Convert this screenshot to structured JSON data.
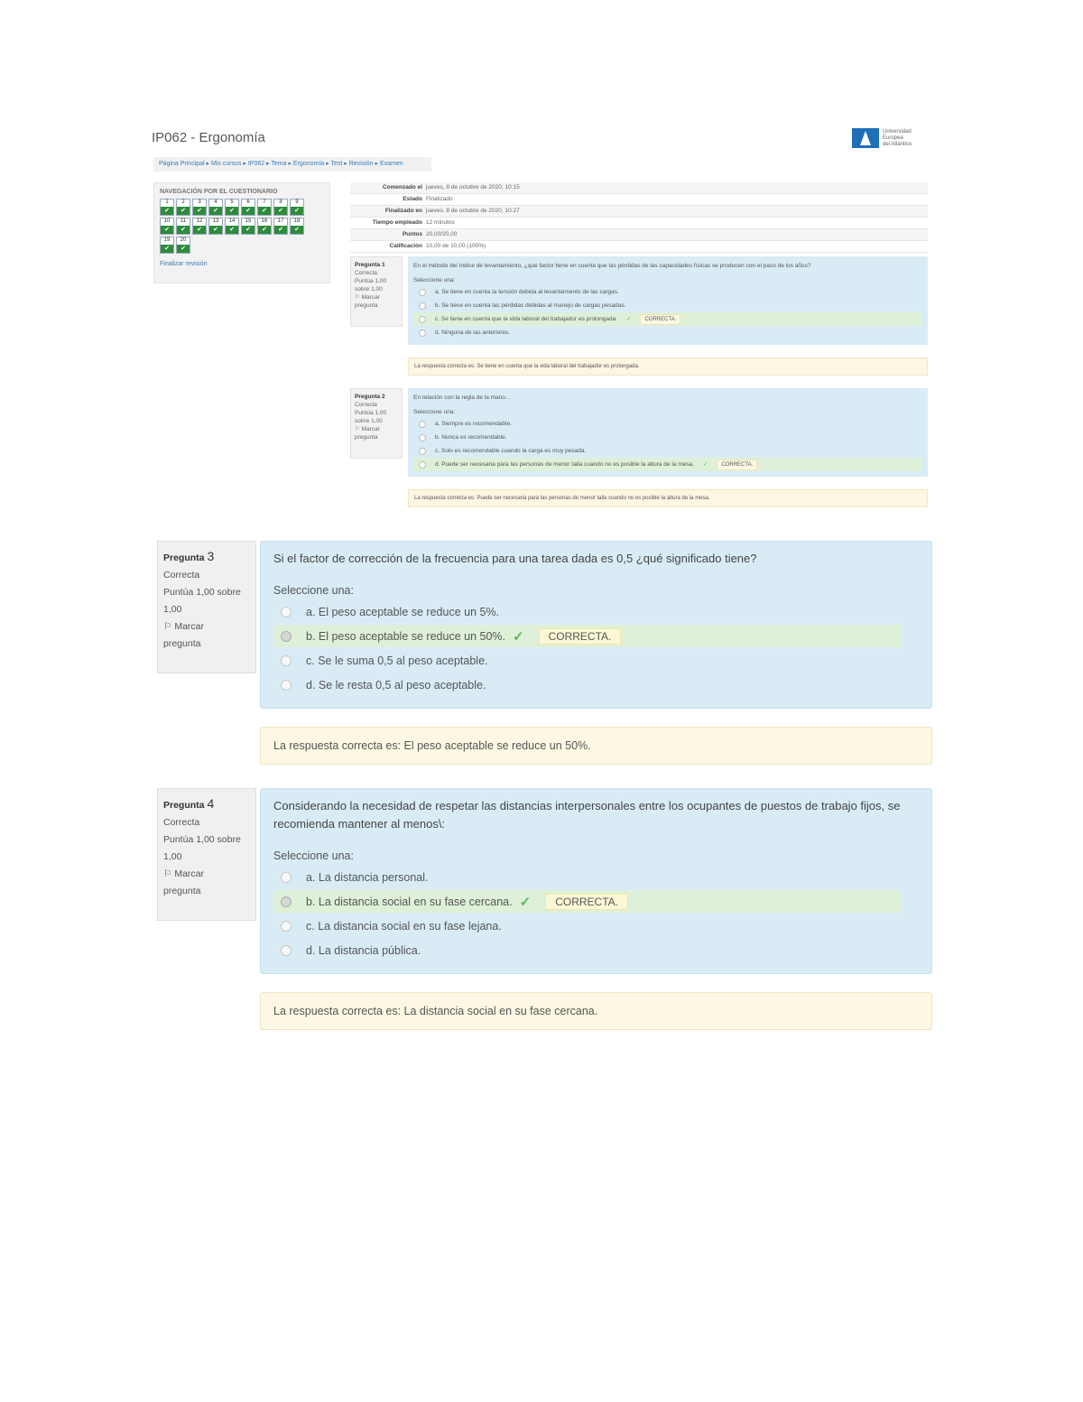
{
  "header": {
    "course_title": "IP062 - Ergonomía",
    "logo_line1": "Universidad",
    "logo_line2": "Europea",
    "logo_line3": "del Atlántico",
    "breadcrumb": "Página Principal ▸ Mis cursos ▸ IP062 ▸ Tema ▸ Ergonomía ▸ Test ▸ Revisión ▸ Examen"
  },
  "nav": {
    "title": "NAVEGACIÓN POR EL CUESTIONARIO",
    "questions": [
      "1",
      "2",
      "3",
      "4",
      "5",
      "6",
      "7",
      "8",
      "9",
      "10",
      "11",
      "12",
      "13",
      "14",
      "15",
      "16",
      "17",
      "18",
      "19",
      "20"
    ],
    "check_glyph": "✔",
    "finish_link": "Finalizar revisión"
  },
  "summary": [
    {
      "k": "Comenzado el",
      "v": "jueves, 8 de octubre de 2020, 10:15"
    },
    {
      "k": "Estado",
      "v": "Finalizado"
    },
    {
      "k": "Finalizado en",
      "v": "jueves, 8 de octubre de 2020, 10:27"
    },
    {
      "k": "Tiempo empleado",
      "v": "12 minutos"
    },
    {
      "k": "Puntos",
      "v": "20,00/20,00"
    },
    {
      "k": "Calificación",
      "v": "10,00 de 10,00 (100%)"
    }
  ],
  "small_questions": [
    {
      "label": "Pregunta 1",
      "status": "Correcta",
      "score": "Puntúa 1,00 sobre 1,00",
      "flag": "Marcar pregunta",
      "text": "En el método del índice de levantamiento, ¿qué factor tiene en cuenta que las pérdidas de las capacidades físicas se producen con el paso de los años?",
      "select": "Seleccione una:",
      "options": [
        {
          "text": "a. Se tiene en cuenta la tensión debida al levantamiento de las cargas.",
          "correct": false
        },
        {
          "text": "b. Se tiene en cuenta las pérdidas debidas al manejo de cargas pesadas.",
          "correct": false
        },
        {
          "text": "c. Se tiene en cuenta que la vida laboral del trabajador es prolongada.",
          "correct": true
        },
        {
          "text": "d. Ninguna de las anteriores.",
          "correct": false
        }
      ],
      "badge": "CORRECTA.",
      "feedback": "La respuesta correcta es: Se tiene en cuenta que la vida laboral del trabajador es prolongada."
    },
    {
      "label": "Pregunta 2",
      "status": "Correcta",
      "score": "Puntúa 1,00 sobre 1,00",
      "flag": "Marcar pregunta",
      "text": "En relación con la regla de la mano...",
      "select": "Seleccione una:",
      "options": [
        {
          "text": "a. Siempre es recomendable.",
          "correct": false
        },
        {
          "text": "b. Nunca es recomendable.",
          "correct": false
        },
        {
          "text": "c. Solo es recomendable cuando la carga es muy pesada.",
          "correct": false
        },
        {
          "text": "d. Puede ser necesaria para las personas de menor talla cuando no es posible la altura de la mesa.",
          "correct": true
        }
      ],
      "badge": "CORRECTA.",
      "feedback": "La respuesta correcta es: Puede ser necesaria para las personas de menor talla cuando no es posible la altura de la mesa."
    }
  ],
  "questions": [
    {
      "label_word": "Pregunta",
      "number": "3",
      "status": "Correcta",
      "score_line1": "Puntúa 1,00 sobre",
      "score_line2": "1,00",
      "flag_line1": "Marcar",
      "flag_line2": "pregunta",
      "text": "Si el factor de corrección de la frecuencia para una tarea dada es 0,5 ¿qué significado tiene?",
      "select": "Seleccione una:",
      "options": [
        {
          "text": "a. El peso aceptable se reduce un 5%.",
          "correct": false
        },
        {
          "text": "b. El peso aceptable se reduce un 50%.",
          "correct": true
        },
        {
          "text": "c. Se le suma 0,5 al peso aceptable.",
          "correct": false
        },
        {
          "text": "d. Se le resta 0,5 al peso aceptable.",
          "correct": false
        }
      ],
      "badge": "CORRECTA.",
      "feedback": "La respuesta correcta es: El peso aceptable se reduce un 50%."
    },
    {
      "label_word": "Pregunta",
      "number": "4",
      "status": "Correcta",
      "score_line1": "Puntúa 1,00 sobre",
      "score_line2": "1,00",
      "flag_line1": "Marcar",
      "flag_line2": "pregunta",
      "text": "Considerando la necesidad de respetar las distancias interpersonales entre los ocupantes de puestos de trabajo fijos, se recomienda mantener al menos\\:",
      "select": "Seleccione una:",
      "options": [
        {
          "text": "a. La distancia personal.",
          "correct": false
        },
        {
          "text": "b. La distancia social en su fase cercana.",
          "correct": true
        },
        {
          "text": "c. La distancia social en su fase lejana.",
          "correct": false
        },
        {
          "text": "d. La distancia pública.",
          "correct": false
        }
      ],
      "badge": "CORRECTA.",
      "feedback": "La respuesta correcta es: La distancia social en su fase cercana."
    }
  ],
  "icons": {
    "tick": "✓",
    "flag": "⚐"
  },
  "colors": {
    "question_bg": "#d9ecf6",
    "correct_bg": "#dff0d8",
    "feedback_bg": "#fcf8e3",
    "check_green": "#2e8b3c",
    "logo_blue": "#1d6fb8"
  }
}
